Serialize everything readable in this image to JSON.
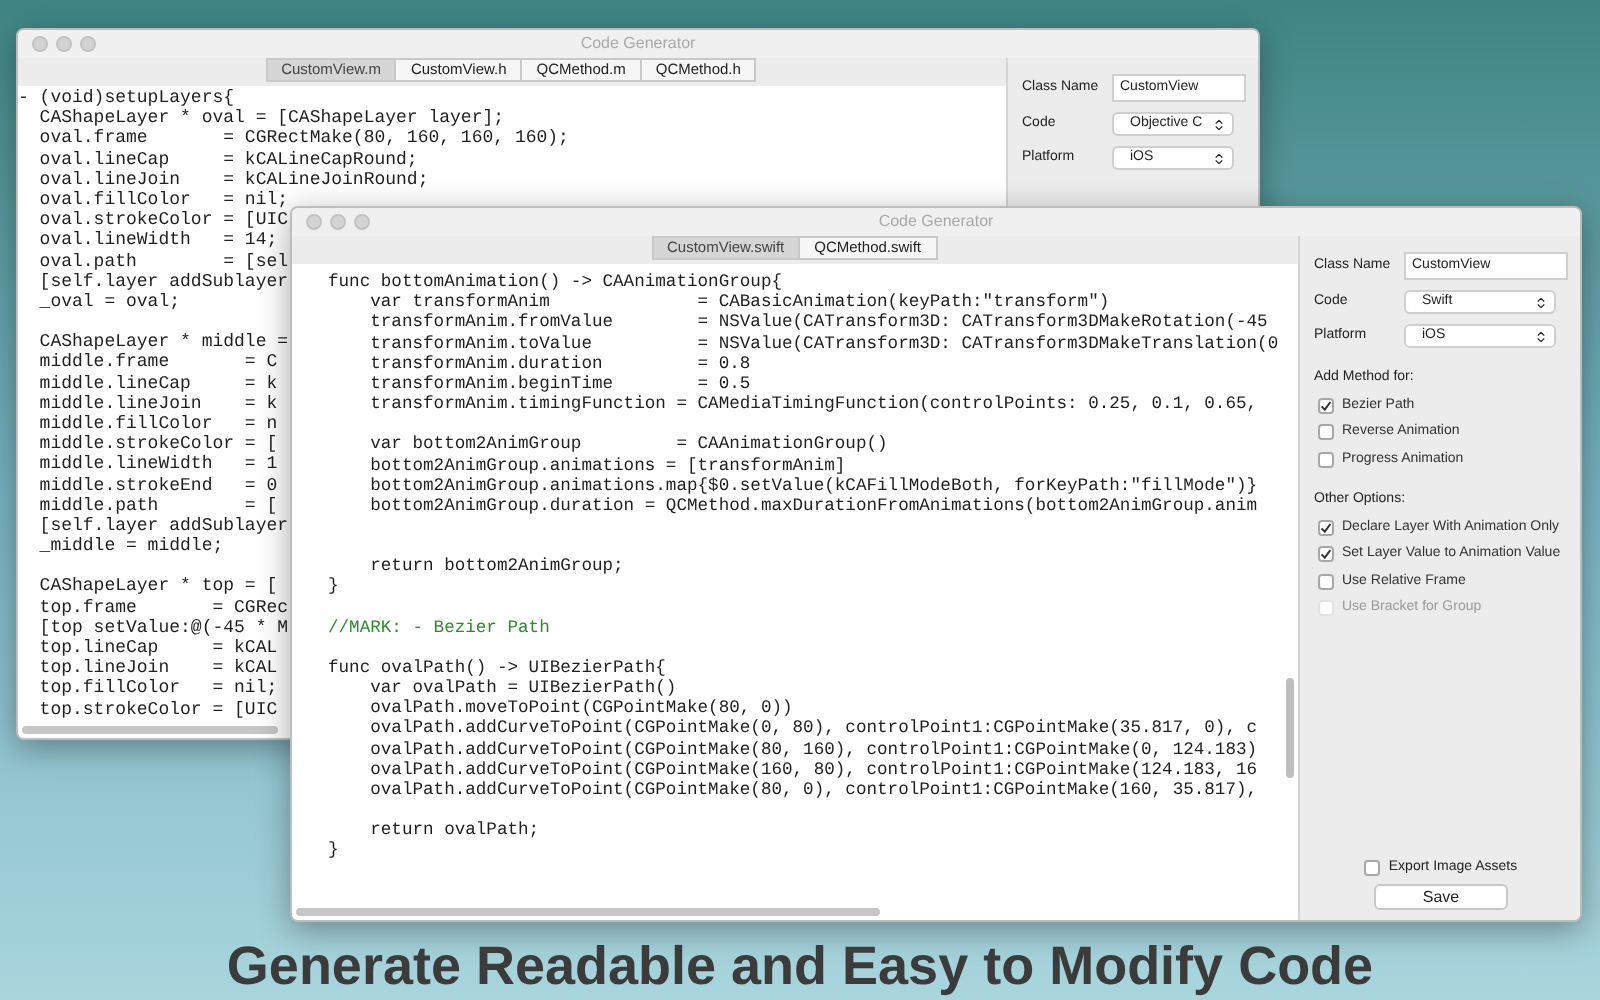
{
  "windows": [
    {
      "title": "Code Generator",
      "tabs": [
        {
          "label": "CustomView.m",
          "selected": true
        },
        {
          "label": "CustomView.h",
          "selected": false
        },
        {
          "label": "QCMethod.m",
          "selected": false
        },
        {
          "label": "QCMethod.h",
          "selected": false
        }
      ],
      "code": [
        {
          "kind": "code",
          "lines": [
            "- (void)setupLayers{",
            "  CAShapeLayer * oval = [CAShapeLayer layer];",
            "  oval.frame       = CGRectMake(80, 160, 160, 160);",
            "  oval.lineCap     = kCALineCapRound;",
            "  oval.lineJoin    = kCALineJoinRound;",
            "  oval.fillColor   = nil;",
            "  oval.strokeColor = [UIC",
            "  oval.lineWidth   = 14;",
            "  oval.path        = [sel",
            "  [self.layer addSublayer",
            "  _oval = oval;"
          ]
        },
        {
          "kind": "code",
          "lines": [
            "  CAShapeLayer * middle =",
            "  middle.frame       = C",
            "  middle.lineCap     = k",
            "  middle.lineJoin    = k",
            "  middle.fillColor   = n",
            "  middle.strokeColor = [",
            "  middle.lineWidth   = 1",
            "  middle.strokeEnd   = 0",
            "  middle.path        = [",
            "  [self.layer addSublayer",
            "  _middle = middle;"
          ]
        },
        {
          "kind": "code",
          "lines": [
            "  CAShapeLayer * top = [",
            "  top.frame       = CGRec",
            "  [top setValue:@(-45 * M",
            "  top.lineCap     = kCAL",
            "  top.lineJoin    = kCAL",
            "  top.fillColor   = nil;",
            "  top.strokeColor = [UIC"
          ]
        }
      ],
      "sidebar": {
        "fields": [
          {
            "kind": "text",
            "label": "Class Name",
            "value": "CustomView"
          },
          {
            "kind": "select",
            "label": "Code",
            "value": "Objective C"
          },
          {
            "kind": "select",
            "label": "Platform",
            "value": "iOS"
          }
        ]
      }
    },
    {
      "title": "Code Generator",
      "tabs": [
        {
          "label": "CustomView.swift",
          "selected": true
        },
        {
          "label": "QCMethod.swift",
          "selected": false
        }
      ],
      "code": [
        {
          "kind": "code",
          "lines": [
            "func bottomAnimation() -> CAAnimationGroup{",
            "    var transformAnim              = CABasicAnimation(keyPath:\"transform\")",
            "    transformAnim.fromValue        = NSValue(CATransform3D: CATransform3DMakeRotation(-45",
            "    transformAnim.toValue          = NSValue(CATransform3D: CATransform3DMakeTranslation(0",
            "    transformAnim.duration         = 0.8",
            "    transformAnim.beginTime        = 0.5",
            "    transformAnim.timingFunction = CAMediaTimingFunction(controlPoints: 0.25, 0.1, 0.65,"
          ]
        },
        {
          "kind": "code",
          "lines": [
            "    var bottom2AnimGroup         = CAAnimationGroup()",
            "    bottom2AnimGroup.animations = [transformAnim]",
            "    bottom2AnimGroup.animations.map{$0.setValue(kCAFillModeBoth, forKeyPath:\"fillMode\")}",
            "    bottom2AnimGroup.duration = QCMethod.maxDurationFromAnimations(bottom2AnimGroup.anim"
          ]
        },
        {
          "kind": "code_spaced",
          "lines": [
            "    return bottom2AnimGroup;",
            "}"
          ]
        },
        {
          "kind": "comment",
          "lines": [
            "//MARK: - Bezier Path"
          ]
        },
        {
          "kind": "code",
          "lines": [
            "func ovalPath() -> UIBezierPath{",
            "    var ovalPath = UIBezierPath()",
            "    ovalPath.moveToPoint(CGPointMake(80, 0))",
            "    ovalPath.addCurveToPoint(CGPointMake(0, 80), controlPoint1:CGPointMake(35.817, 0), c",
            "    ovalPath.addCurveToPoint(CGPointMake(80, 160), controlPoint1:CGPointMake(0, 124.183)",
            "    ovalPath.addCurveToPoint(CGPointMake(160, 80), controlPoint1:CGPointMake(124.183, 16",
            "    ovalPath.addCurveToPoint(CGPointMake(80, 0), controlPoint1:CGPointMake(160, 35.817),"
          ]
        },
        {
          "kind": "code",
          "lines": [
            "    return ovalPath;",
            "}"
          ]
        }
      ],
      "sidebar": {
        "fields": [
          {
            "kind": "text",
            "label": "Class Name",
            "value": "CustomView"
          },
          {
            "kind": "select",
            "label": "Code",
            "value": "Swift"
          },
          {
            "kind": "select",
            "label": "Platform",
            "value": "iOS"
          }
        ],
        "sections": [
          {
            "heading": "Add Method for:",
            "options": [
              {
                "label": "Bezier Path",
                "checked": true,
                "disabled": false
              },
              {
                "label": "Reverse Animation",
                "checked": false,
                "disabled": false
              },
              {
                "label": "Progress Animation",
                "checked": false,
                "disabled": false
              }
            ]
          },
          {
            "heading": "Other Options:",
            "options": [
              {
                "label": "Declare Layer With Animation Only",
                "checked": true,
                "disabled": false
              },
              {
                "label": "Set Layer Value to Animation Value",
                "checked": true,
                "disabled": false
              },
              {
                "label": "Use Relative Frame",
                "checked": false,
                "disabled": false
              },
              {
                "label": "Use Bracket for Group",
                "checked": false,
                "disabled": true
              }
            ]
          }
        ],
        "export": {
          "label": "Export Image Assets",
          "checked": false
        },
        "button": "Save"
      }
    }
  ],
  "caption": "Generate Readable and Easy to Modify Code"
}
